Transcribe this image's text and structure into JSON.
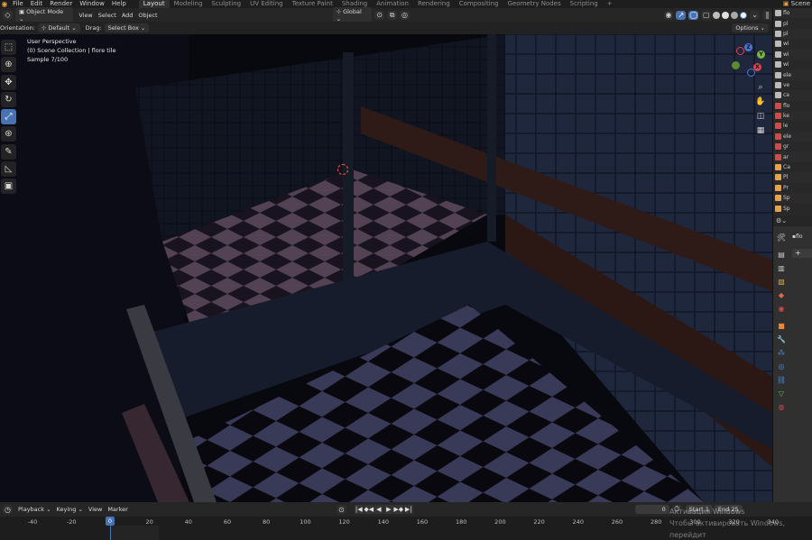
{
  "top_menu": [
    "File",
    "Edit",
    "Render",
    "Window",
    "Help"
  ],
  "workspaces": [
    "Layout",
    "Modeling",
    "Sculpting",
    "UV Editing",
    "Texture Paint",
    "Shading",
    "Animation",
    "Rendering",
    "Compositing",
    "Geometry Nodes",
    "Scripting"
  ],
  "active_workspace": "Layout",
  "add_workspace": "+",
  "scene_name": "Scene",
  "header": {
    "mode": "Object Mode",
    "menus": [
      "View",
      "Select",
      "Add",
      "Object"
    ],
    "transform_orientation": "Global",
    "options": "Options"
  },
  "tool_settings": {
    "orientation_label": "Orientation:",
    "orientation_value": "Default",
    "drag_label": "Drag:",
    "drag_value": "Select Box"
  },
  "viewport": {
    "line1": "User Perspective",
    "line2": "(0) Scene Collection | flore tile",
    "line3": "Sample 7/100"
  },
  "gizmo": {
    "x": "X",
    "y": "Y",
    "z": "Z"
  },
  "outliner_rows": [
    "flo",
    "pl",
    "pl",
    "wi",
    "wi",
    "wi",
    "ele",
    "ve",
    "ca",
    "flo",
    "ke",
    "le",
    "ele",
    "gr",
    "ar",
    "Ca",
    "Pl",
    "Pr",
    "Sp",
    "Sp"
  ],
  "properties": {
    "object_name": "flo",
    "add_button": "+"
  },
  "timeline": {
    "menus": [
      "Playback",
      "Keying",
      "View",
      "Marker"
    ],
    "current_frame": "0",
    "start_label": "Start",
    "start_value": "1",
    "end_label": "End",
    "end_value": "25",
    "ticks": [
      "-40",
      "-20",
      "0",
      "20",
      "40",
      "60",
      "80",
      "100",
      "120",
      "140",
      "160",
      "180",
      "200",
      "220",
      "240",
      "260",
      "280",
      "300",
      "320",
      "340"
    ]
  },
  "watermark": {
    "line1": "Активация Windows",
    "line2": "Чтобы активировать Windows, перейдит"
  },
  "colors": {
    "accent": "#4772b3",
    "active_frame": "#4772b3"
  }
}
